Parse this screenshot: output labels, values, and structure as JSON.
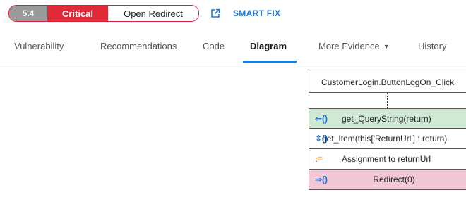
{
  "header": {
    "score": "5.4",
    "severity": "Critical",
    "category": "Open Redirect",
    "smartfix_label": "SMART FIX",
    "smartfix_icon": "external-link-icon"
  },
  "tabs": [
    {
      "label": "Vulnerability"
    },
    {
      "label": "Recommendations"
    },
    {
      "label": "Code"
    },
    {
      "label": "Diagram",
      "active": true
    },
    {
      "label": "More Evidence"
    },
    {
      "label": "History"
    }
  ],
  "diagram": {
    "root": "CustomerLogin.ButtonLogOn_Click",
    "steps": [
      {
        "icon": "⇐()",
        "icon_name": "return-arrow-icon",
        "label": "get_QueryString(return)",
        "color": "#cfe9d5"
      },
      {
        "icon": "⇕()",
        "icon_name": "bidirectional-call-icon",
        "label": "get_Item(this['ReturnUrl'] : return)"
      },
      {
        "icon": ":=",
        "icon_name": "assignment-icon",
        "label": "Assignment to returnUrl"
      },
      {
        "icon": "⇒()",
        "icon_name": "sink-call-icon",
        "label": "Redirect(0)",
        "color": "#f3c8d6"
      }
    ]
  },
  "colors": {
    "accent": "#1e7bd6",
    "critical": "#e02a38",
    "score_bg": "#9a9a9a"
  }
}
